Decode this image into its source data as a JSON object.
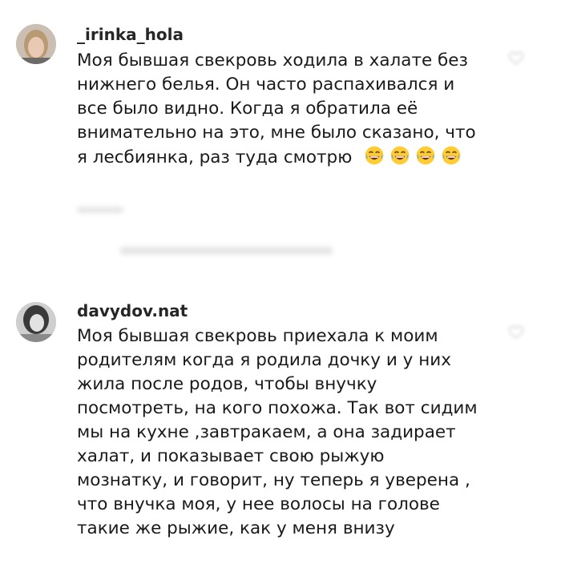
{
  "comments": [
    {
      "username": "_irinka_hola",
      "time": "",
      "text": "Моя бывшая свекровь ходила в халате без нижнего белья. Он часто распахивался и все было видно. Когда я обратила её внимательно на это, мне было сказано, что я лесбиянка, раз туда смотрю",
      "emojis": [
        "laughing-tears-emoji",
        "laughing-tears-emoji",
        "laughing-tears-emoji",
        "laughing-tears-emoji"
      ]
    },
    {
      "username": "davydov.nat",
      "time": "",
      "text": "Моя бывшая свекровь приехала к моим родителям когда я родила дочку и у них жила после родов, чтобы внучку посмотреть, на кого похожа. Так вот сидим мы на кухне ,завтракаем, а она задирает халат, и показывает свою рыжую мознатку, и говорит, ну теперь я уверена , что внучка моя, у нее волосы на голове такие же рыжие, как у меня внизу"
    }
  ],
  "icons": {
    "like": "heart-icon"
  },
  "colors": {
    "text": "#1a1a1a",
    "username": "#262626",
    "muted": "#c7c7c7"
  }
}
